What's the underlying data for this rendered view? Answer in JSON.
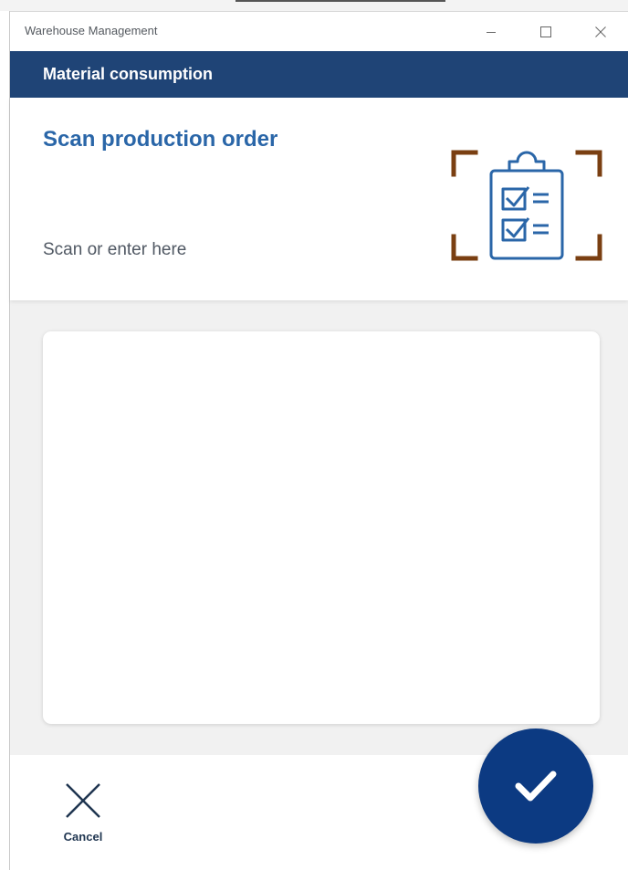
{
  "window": {
    "title": "Warehouse Management"
  },
  "header": {
    "title": "Material consumption"
  },
  "scan": {
    "title": "Scan production order",
    "value": "",
    "placeholder": "Scan or enter here",
    "illustration": "clipboard-checklist-scan-icon"
  },
  "footer": {
    "cancel_label": "Cancel",
    "cancel_icon": "close-icon",
    "confirm_icon": "checkmark-icon"
  },
  "colors": {
    "header_bg": "#1f4476",
    "title_blue": "#2a66a8",
    "accent_brown": "#7a3f12",
    "confirm_bg": "#0c3a82",
    "content_bg": "#f1f1f1"
  }
}
